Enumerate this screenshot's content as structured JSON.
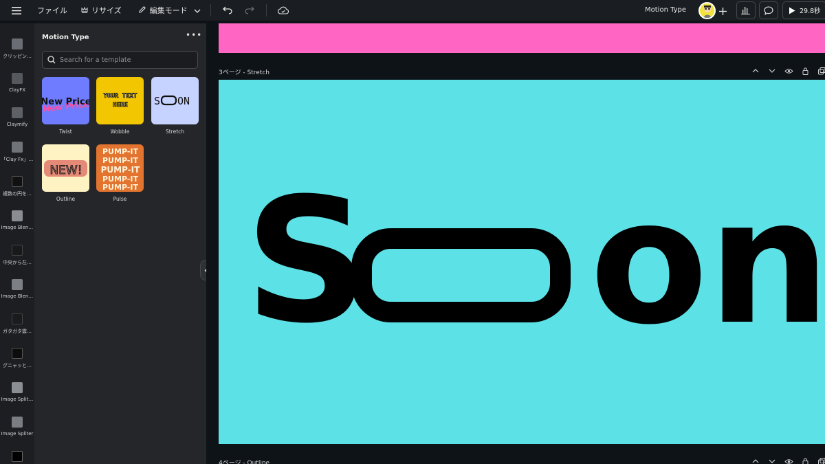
{
  "topbar": {
    "file_label": "ファイル",
    "resize_label": "リサイズ",
    "edit_mode_label": "編集モード",
    "project_name": "Motion Type",
    "play_duration": "29.8秒"
  },
  "rail": {
    "items": [
      {
        "label": "クリッピン…"
      },
      {
        "label": "ClayFX"
      },
      {
        "label": "Claymify"
      },
      {
        "label": "「Clay Fx」…"
      },
      {
        "label": "複数の円を…"
      },
      {
        "label": "Image Blen…"
      },
      {
        "label": "中央から左…"
      },
      {
        "label": "Image Blen…"
      },
      {
        "label": "ガタガタ震…"
      },
      {
        "label": "グニャッと…"
      },
      {
        "label": "Image Split…"
      },
      {
        "label": "Image Spliter"
      }
    ]
  },
  "panel": {
    "title": "Motion Type",
    "search_placeholder": "Search for a template",
    "templates": [
      {
        "name": "Twist",
        "preview_text": "New Price",
        "bg": "#6f7cff"
      },
      {
        "name": "Wobble",
        "preview_text_1": "YOUR TEXT",
        "preview_text_2": "HERE",
        "bg": "#f2c600"
      },
      {
        "name": "Stretch",
        "preview_text_1": "S",
        "preview_text_2": "ON",
        "bg": "#c6d2ff"
      },
      {
        "name": "Outline",
        "preview_text": "NEW!",
        "bg": "#fff3c4"
      },
      {
        "name": "Pulse",
        "preview_text": "PUMP-IT",
        "bg": "#e2742f"
      }
    ]
  },
  "canvas": {
    "page3_label": "3ページ - Stretch",
    "page4_label": "4ページ - Outline",
    "main_text_1": "S",
    "main_text_2": "on",
    "page_top_color": "#ff66c4",
    "page_main_color": "#5ce1e6"
  }
}
